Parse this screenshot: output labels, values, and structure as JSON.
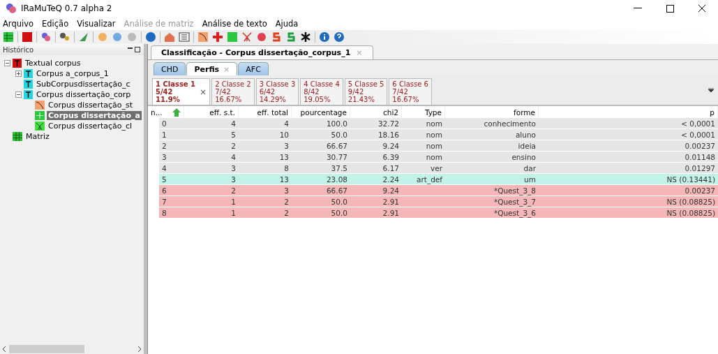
{
  "window": {
    "title": "IRaMuTeQ 0.7 alpha 2"
  },
  "menu": [
    {
      "label": "Arquivo",
      "disabled": false
    },
    {
      "label": "Edição",
      "disabled": false
    },
    {
      "label": "Visualizar",
      "disabled": false
    },
    {
      "label": "Análise de matriz",
      "disabled": true
    },
    {
      "label": "Análise de texto",
      "disabled": false
    },
    {
      "label": "Ajuda",
      "disabled": false
    }
  ],
  "sidebar": {
    "title": "Histórico",
    "tree": [
      {
        "label": "Textual corpus",
        "kind": "text-red",
        "expanded": true,
        "selected": false,
        "children": [
          {
            "label": "Corpus a_corpus_1",
            "kind": "text-cyan",
            "expanded": false,
            "selected": false
          },
          {
            "label": "SubCorpusdissertação_c",
            "kind": "text-cyan",
            "selected": false
          },
          {
            "label": "Corpus dissertação_corp",
            "kind": "text-cyan",
            "expanded": true,
            "selected": false,
            "children": [
              {
                "label": "Corpus dissertação_st",
                "kind": "curve",
                "selected": false
              },
              {
                "label": "Corpus dissertação_a",
                "kind": "grid",
                "selected": true
              },
              {
                "label": "Corpus dissertação_cl",
                "kind": "tree",
                "selected": false
              }
            ]
          }
        ]
      },
      {
        "label": "Matriz",
        "kind": "matrix",
        "selected": false
      }
    ]
  },
  "document_tabs": [
    {
      "label": "Classificação - Corpus dissertação_corpus_1",
      "close": "×",
      "selected": true
    }
  ],
  "analysis_tabs": [
    {
      "label": "CHD",
      "selected": false
    },
    {
      "label": "Perfis",
      "close": "×",
      "selected": true
    },
    {
      "label": "AFC",
      "selected": false
    }
  ],
  "class_tabs": [
    {
      "title": "1 Classe 1",
      "count": "5/42",
      "percent": "11.9%",
      "close": "×",
      "selected": true
    },
    {
      "title": "2 Classe 2",
      "count": "7/42",
      "percent": "16.67%",
      "selected": false
    },
    {
      "title": "3 Classe 3",
      "count": "6/42",
      "percent": "14.29%",
      "selected": false
    },
    {
      "title": "4 Classe 4",
      "count": "8/42",
      "percent": "19.05%",
      "selected": false
    },
    {
      "title": "5 Classe 5",
      "count": "9/42",
      "percent": "21.43%",
      "selected": false
    },
    {
      "title": "6 Classe 6",
      "count": "7/42",
      "percent": "16.67%",
      "selected": false
    }
  ],
  "table": {
    "columns": [
      "n...",
      "eff. s.t.",
      "eff. total",
      "pourcentage",
      "chi2",
      "Type",
      "forme",
      "p"
    ],
    "rows": [
      {
        "color": "#e6e6e6",
        "cells": [
          "0",
          "4",
          "4",
          "100.0",
          "32.72",
          "nom",
          "conhecimento",
          "< 0,0001"
        ]
      },
      {
        "color": "#e6e6e6",
        "cells": [
          "1",
          "5",
          "10",
          "50.0",
          "18.16",
          "nom",
          "aluno",
          "< 0,0001"
        ]
      },
      {
        "color": "#e6e6e6",
        "cells": [
          "2",
          "2",
          "3",
          "66.67",
          "9.24",
          "nom",
          "ideia",
          "0.00237"
        ]
      },
      {
        "color": "#e6e6e6",
        "cells": [
          "3",
          "4",
          "13",
          "30.77",
          "6.39",
          "nom",
          "ensino",
          "0.01148"
        ]
      },
      {
        "color": "#e6e6e6",
        "cells": [
          "4",
          "3",
          "8",
          "37.5",
          "6.17",
          "ver",
          "dar",
          "0.01297"
        ]
      },
      {
        "color": "#c2f2e8",
        "cells": [
          "5",
          "3",
          "13",
          "23.08",
          "2.24",
          "art_def",
          "um",
          "NS (0.13441)"
        ]
      },
      {
        "color": "#f4b6b6",
        "cells": [
          "6",
          "2",
          "3",
          "66.67",
          "9.24",
          "",
          "*Quest_3_8",
          "0.00237"
        ]
      },
      {
        "color": "#f4b6b6",
        "cells": [
          "7",
          "1",
          "2",
          "50.0",
          "2.91",
          "",
          "*Quest_3_7",
          "NS (0.08825)"
        ]
      },
      {
        "color": "#f4b6b6",
        "cells": [
          "8",
          "1",
          "2",
          "50.0",
          "2.91",
          "",
          "*Quest_3_6",
          "NS (0.08825)"
        ]
      }
    ]
  }
}
